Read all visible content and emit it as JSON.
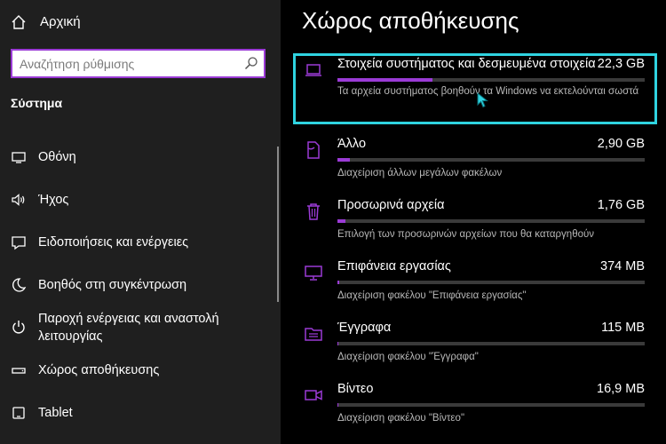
{
  "sidebar": {
    "home_label": "Αρχική",
    "search_placeholder": "Αναζήτηση ρύθμισης",
    "section_title": "Σύστημα",
    "items": [
      {
        "label": "Οθόνη",
        "icon": "display-icon"
      },
      {
        "label": "Ήχος",
        "icon": "speaker-icon"
      },
      {
        "label": "Ειδοποιήσεις και ενέργειες",
        "icon": "notification-icon"
      },
      {
        "label": "Βοηθός στη συγκέντρωση",
        "icon": "moon-icon"
      },
      {
        "label": "Παροχή ενέργειας και αναστολή λειτουργίας",
        "icon": "power-icon"
      },
      {
        "label": "Χώρος αποθήκευσης",
        "icon": "storage-icon"
      },
      {
        "label": "Tablet",
        "icon": "tablet-icon"
      }
    ]
  },
  "main": {
    "title": "Χώρος αποθήκευσης",
    "items": [
      {
        "name": "Στοιχεία συστήματος και δεσμευμένα στοιχεία",
        "size": "22,3 GB",
        "usage": 0.31,
        "desc": "Τα αρχεία συστήματος βοηθούν τα Windows να εκτελούνται σωστά",
        "icon": "laptop-icon"
      },
      {
        "name": "Άλλο",
        "size": "2,90 GB",
        "usage": 0.04,
        "desc": "Διαχείριση άλλων μεγάλων φακέλων",
        "icon": "document-icon"
      },
      {
        "name": "Προσωρινά αρχεία",
        "size": "1,76 GB",
        "usage": 0.025,
        "desc": "Επιλογή των προσωρινών αρχείων που θα καταργηθούν",
        "icon": "trash-icon"
      },
      {
        "name": "Επιφάνεια εργασίας",
        "size": "374 MB",
        "usage": 0.006,
        "desc": "Διαχείριση φακέλου \"Επιφάνεια εργασίας\"",
        "icon": "monitor-icon"
      },
      {
        "name": "Έγγραφα",
        "size": "115 MB",
        "usage": 0.004,
        "desc": "Διαχείριση φακέλου \"Έγγραφα\"",
        "icon": "folder-icon"
      },
      {
        "name": "Βίντεο",
        "size": "16,9 MB",
        "usage": 0.003,
        "desc": "Διαχείριση φακέλου \"Βίντεο\"",
        "icon": "video-icon"
      }
    ]
  },
  "colors": {
    "accent": "#9b3bd6",
    "selection": "#2fd3e0",
    "sidebar_bg": "#1f1f1f",
    "main_bg": "#000000"
  }
}
